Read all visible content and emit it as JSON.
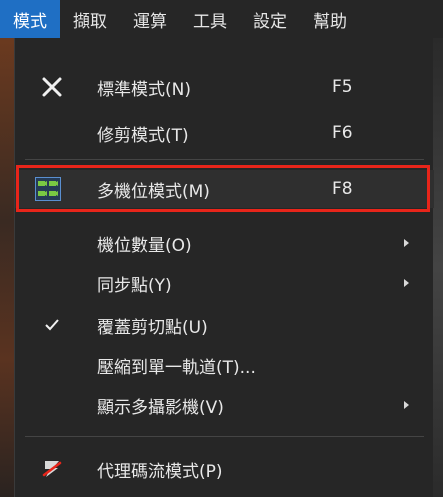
{
  "menubar": {
    "items": [
      {
        "label": "模式"
      },
      {
        "label": "擷取"
      },
      {
        "label": "運算"
      },
      {
        "label": "工具"
      },
      {
        "label": "設定"
      },
      {
        "label": "幫助"
      }
    ]
  },
  "menu": {
    "standard_mode": {
      "label": "標準模式(N)",
      "shortcut": "F5"
    },
    "trim_mode": {
      "label": "修剪模式(T)",
      "shortcut": "F6"
    },
    "multicam_mode": {
      "label": "多機位模式(M)",
      "shortcut": "F8"
    },
    "camera_count": {
      "label": "機位數量(O)"
    },
    "sync_point": {
      "label": "同步點(Y)"
    },
    "overwrite_clip": {
      "label": "覆蓋剪切點(U)"
    },
    "collapse_to_track": {
      "label": "壓縮到單一軌道(T)..."
    },
    "show_multicam": {
      "label": "顯示多攝影機(V)"
    },
    "proxy_stream_mode": {
      "label": "代理碼流模式(P)"
    }
  },
  "colors": {
    "active_menu": "#1f6fc4",
    "highlight_border": "#e8251a",
    "multicam_icon": "#7ac943"
  }
}
